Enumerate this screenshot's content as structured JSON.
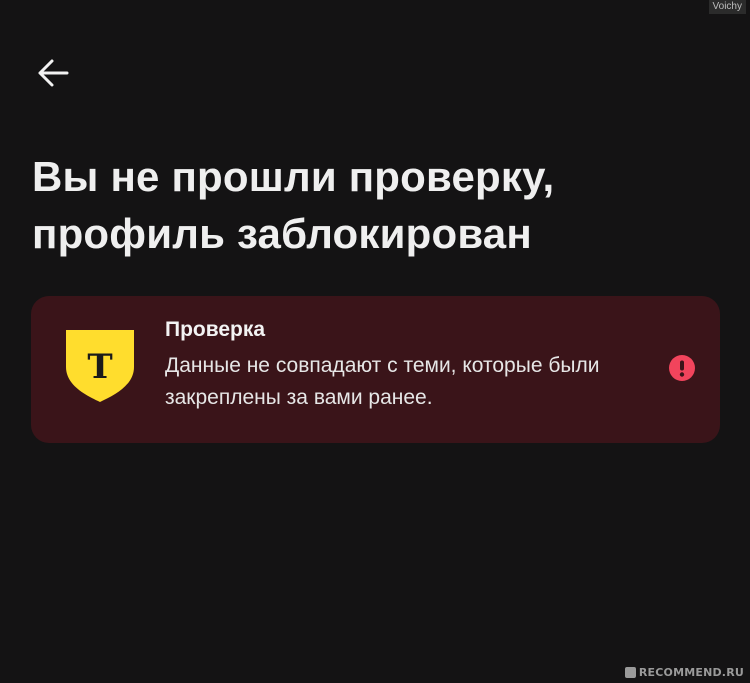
{
  "header": {
    "back_icon": "arrow-left-icon"
  },
  "main": {
    "title_line1": "Вы не прошли проверку,",
    "title_line2": "профиль заблокирован"
  },
  "alert_card": {
    "logo_icon": "tinkoff-shield-logo",
    "logo_letter": "Т",
    "title": "Проверка",
    "message": "Данные не совпадают с теми, которые были закреплены за вами ранее.",
    "status_icon": "error-exclamation-icon"
  },
  "watermarks": {
    "top": "Voichy",
    "bottom": "RECOMMEND.RU"
  },
  "colors": {
    "background": "#141314",
    "card_background": "#3a1419",
    "logo_yellow": "#ffdd2d",
    "error_red": "#f2445c",
    "text": "#efefef"
  }
}
